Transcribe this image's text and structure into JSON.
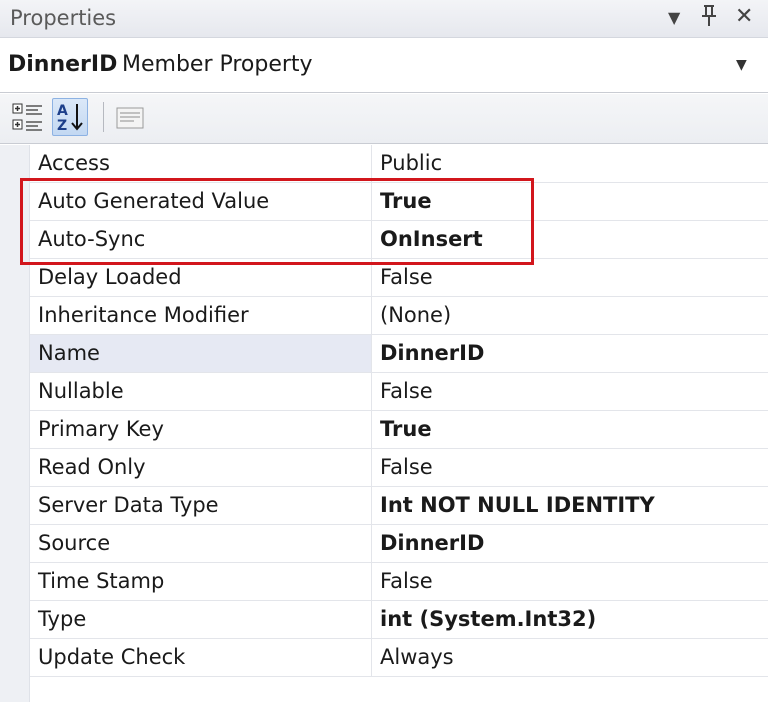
{
  "window": {
    "title": "Properties"
  },
  "object_selector": {
    "name": "DinnerID",
    "kind": "Member Property"
  },
  "properties": [
    {
      "name": "Access",
      "value": "Public",
      "bold": false
    },
    {
      "name": "Auto Generated Value",
      "value": "True",
      "bold": true
    },
    {
      "name": "Auto-Sync",
      "value": "OnInsert",
      "bold": true
    },
    {
      "name": "Delay Loaded",
      "value": "False",
      "bold": false
    },
    {
      "name": "Inheritance Modifier",
      "value": "(None)",
      "bold": false
    },
    {
      "name": "Name",
      "value": "DinnerID",
      "bold": true,
      "selected": true
    },
    {
      "name": "Nullable",
      "value": "False",
      "bold": false
    },
    {
      "name": "Primary Key",
      "value": "True",
      "bold": true
    },
    {
      "name": "Read Only",
      "value": "False",
      "bold": false
    },
    {
      "name": "Server Data Type",
      "value": "Int NOT NULL IDENTITY",
      "bold": true
    },
    {
      "name": "Source",
      "value": "DinnerID",
      "bold": true
    },
    {
      "name": "Time Stamp",
      "value": "False",
      "bold": false
    },
    {
      "name": "Type",
      "value": "int (System.Int32)",
      "bold": true
    },
    {
      "name": "Update Check",
      "value": "Always",
      "bold": false
    }
  ],
  "highlight_color": "#d2161c"
}
